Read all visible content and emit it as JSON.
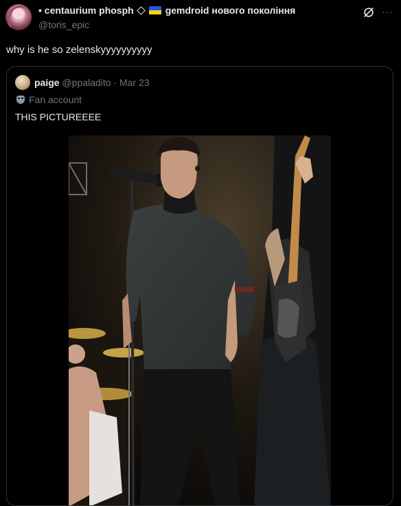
{
  "author": {
    "name_prefix": "• centaurium phosph",
    "name_suffix": "gemdroid нового покоління",
    "handle": "@toris_epic"
  },
  "post": {
    "text": "why is he so zelenskyyyyyyyyyy"
  },
  "quoted": {
    "name": "paige",
    "meta": "@ppaladito · Mar 23",
    "label": "Fan account",
    "text": "THIS PICTUREEEE"
  },
  "icons": {
    "grok": "grok-icon",
    "more": "more-icon",
    "flag": "ukraine-flag-icon",
    "mask": "mask-icon"
  },
  "colors": {
    "background": "#000000",
    "text_primary": "#e7e9ea",
    "text_secondary": "#71767b",
    "border": "#2f3336",
    "flag_blue": "#1f5bd6",
    "flag_yellow": "#f7d21a"
  }
}
